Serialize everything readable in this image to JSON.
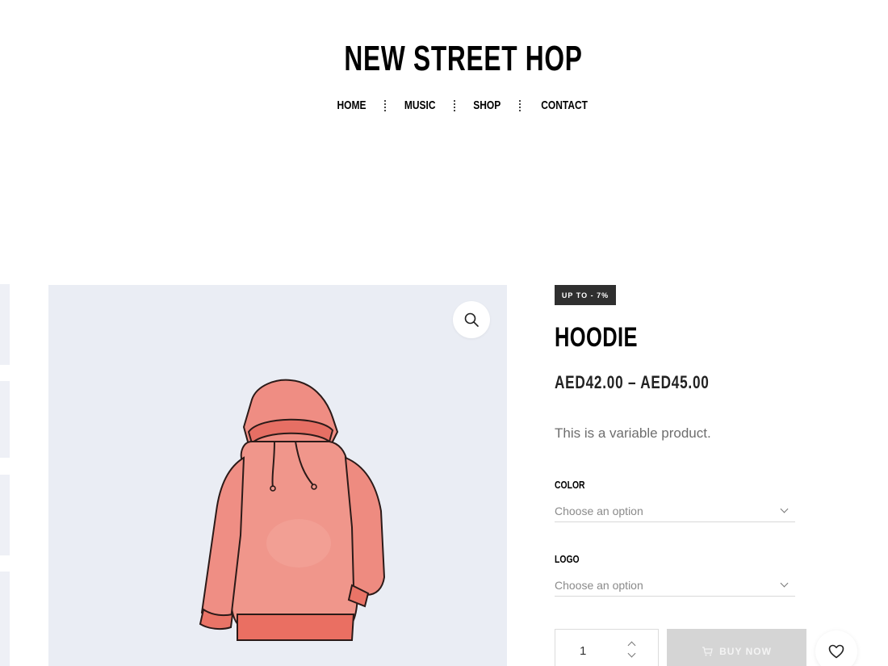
{
  "header": {
    "site_title": "NEW STREET HOP",
    "nav": [
      "HOME",
      "MUSIC",
      "SHOP",
      "CONTACT"
    ]
  },
  "gallery": {
    "zoom_icon": "search-icon",
    "image": "hoodie-illustration"
  },
  "product": {
    "badge": "UP TO - 7%",
    "title": "HOODIE",
    "price": "AED42.00 – AED45.00",
    "short_description": "This is a variable product.",
    "attributes": [
      {
        "label": "COLOR",
        "placeholder": "Choose an option"
      },
      {
        "label": "LOGO",
        "placeholder": "Choose an option"
      }
    ],
    "quantity": "1",
    "buy_now_label": "BUY NOW",
    "wishlist_icon": "heart-icon"
  },
  "colors": {
    "badge_bg": "#2f2f2f",
    "gallery_bg": "#eaedf4",
    "hoodie": "#ee8a80",
    "button_disabled": "#d5d5d5"
  }
}
